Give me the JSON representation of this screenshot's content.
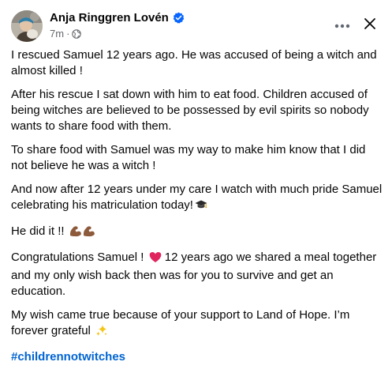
{
  "post": {
    "author_name": "Anja Ringgren Lovén",
    "timestamp": "7m",
    "meta_separator": "·",
    "audience_icon": "globe-icon",
    "verified_icon": "verified-badge-icon",
    "paragraphs": [
      "I rescued Samuel 12 years ago. He was accused of being a witch and almost killed !",
      "After his rescue I sat down with him to eat food. Children accused of being witches are believed to be possessed by evil spirits so nobody wants to share food with them.",
      "To share food with Samuel was my way to make him know that I did not believe he was a witch !",
      "And now after 12 years under my care I watch with much pride Samuel celebrating his matriculation today!",
      "He did it !!",
      "Congratulations Samuel !",
      "12 years ago we shared a meal together and my only wish back then was for you to survive and get an education.",
      "My wish came true because of your support to Land of Hope. I’m forever grateful"
    ],
    "hashtag": "#childrennotwitches",
    "emojis": {
      "graduation": "graduation-cap-icon",
      "strong": "flexed-biceps-icon",
      "heart": "red-heart-icon",
      "sparkles": "sparkles-icon"
    }
  },
  "header_actions": {
    "more": "more-options-icon",
    "close": "close-icon"
  },
  "colors": {
    "text": "#050505",
    "secondary_text": "#65676b",
    "verified_blue": "#0866ff",
    "hashtag_blue": "#0064d1",
    "heart_red": "#e0245e",
    "sparkle_yellow": "#f5c518"
  }
}
